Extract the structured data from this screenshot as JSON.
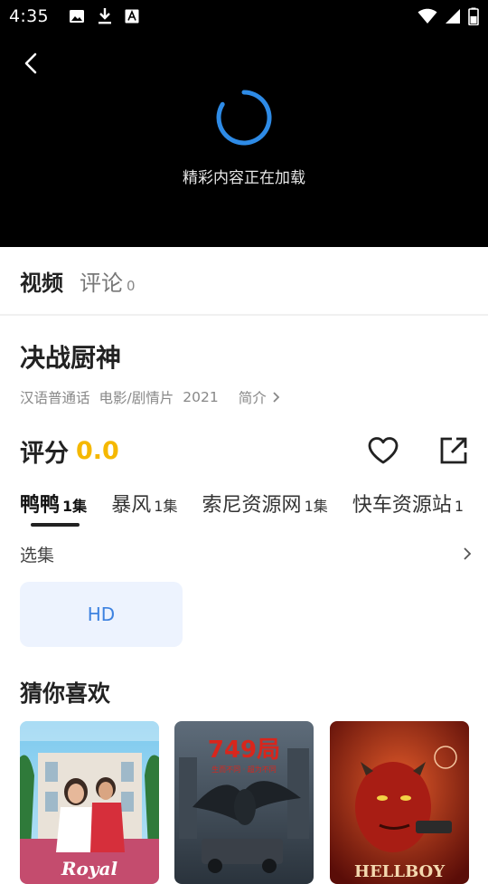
{
  "status_bar": {
    "time": "4:35",
    "icons_left": [
      "image-icon",
      "download-icon",
      "accessibility-a-icon"
    ],
    "icons_right": [
      "wifi-icon",
      "signal-icon",
      "battery-icon"
    ]
  },
  "player": {
    "loading_text": "精彩内容正在加载"
  },
  "tabs": {
    "video_label": "视频",
    "comment_label": "评论",
    "comment_count": "0"
  },
  "movie": {
    "title": "决战厨神",
    "language": "汉语普通话",
    "genre": "电影/剧情片",
    "year": "2021",
    "intro_label": "简介"
  },
  "rating": {
    "label": "评分",
    "value": "0.0"
  },
  "sources": [
    {
      "name": "鸭鸭",
      "count": "1集",
      "active": true
    },
    {
      "name": "暴风",
      "count": "1集",
      "active": false
    },
    {
      "name": "索尼资源网",
      "count": "1集",
      "active": false
    },
    {
      "name": "快车资源站",
      "count": "1",
      "active": false
    }
  ],
  "episodes": {
    "label": "选集",
    "items": [
      "HD"
    ]
  },
  "recommend": {
    "title": "猜你喜欢",
    "posters": [
      {
        "title_art": "Royal"
      },
      {
        "title_art": "749局"
      },
      {
        "title_art": "HELLBOY"
      }
    ]
  },
  "colors": {
    "rating_accent": "#f5b800",
    "spinner": "#2e8be6",
    "episode_chip_bg": "#edf3fe",
    "episode_chip_text": "#3d82e0"
  }
}
